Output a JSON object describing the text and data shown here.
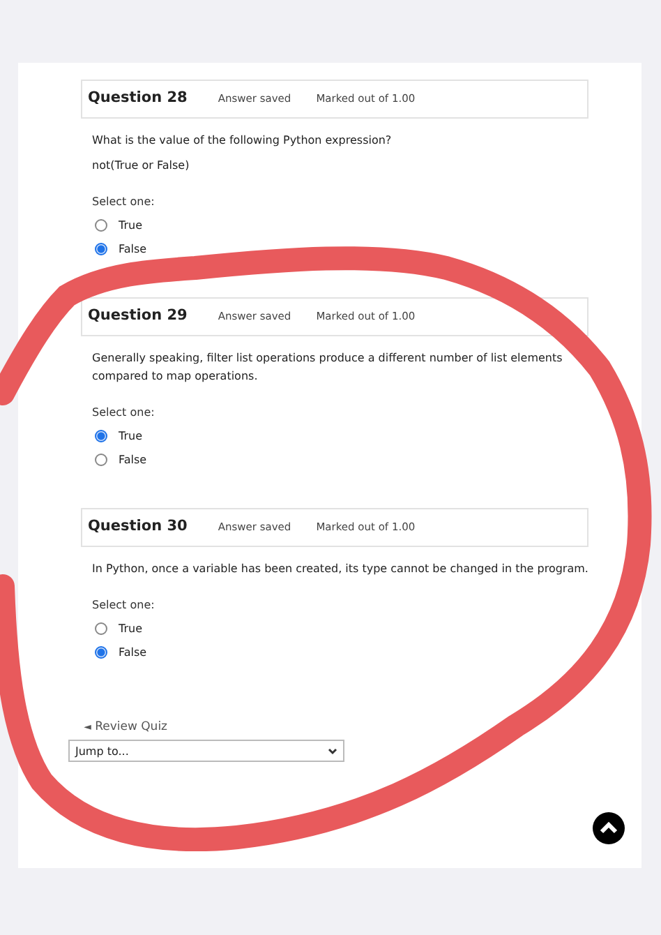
{
  "questions": [
    {
      "title": "Question 28",
      "status": "Answer saved",
      "marks": "Marked out of 1.00",
      "text": [
        "What is the value of the following Python expression?",
        "not(True or False)"
      ],
      "prompt": "Select one:",
      "options": [
        {
          "label": "True",
          "selected": false
        },
        {
          "label": "False",
          "selected": true
        }
      ]
    },
    {
      "title": "Question 29",
      "status": "Answer saved",
      "marks": "Marked out of 1.00",
      "text": [
        "Generally speaking, filter list operations produce a different number of list elements compared to map operations."
      ],
      "prompt": "Select one:",
      "options": [
        {
          "label": "True",
          "selected": true
        },
        {
          "label": "False",
          "selected": false
        }
      ]
    },
    {
      "title": "Question 30",
      "status": "Answer saved",
      "marks": "Marked out of 1.00",
      "text": [
        "In Python, once a variable has been created, its type cannot be changed in the program."
      ],
      "prompt": "Select one:",
      "options": [
        {
          "label": "True",
          "selected": false
        },
        {
          "label": "False",
          "selected": true
        }
      ]
    }
  ],
  "review_link": {
    "icon": "◄",
    "label": "Review Quiz"
  },
  "jump": {
    "value": "Jump to..."
  },
  "annotation": {
    "kind": "freehand-loop"
  }
}
